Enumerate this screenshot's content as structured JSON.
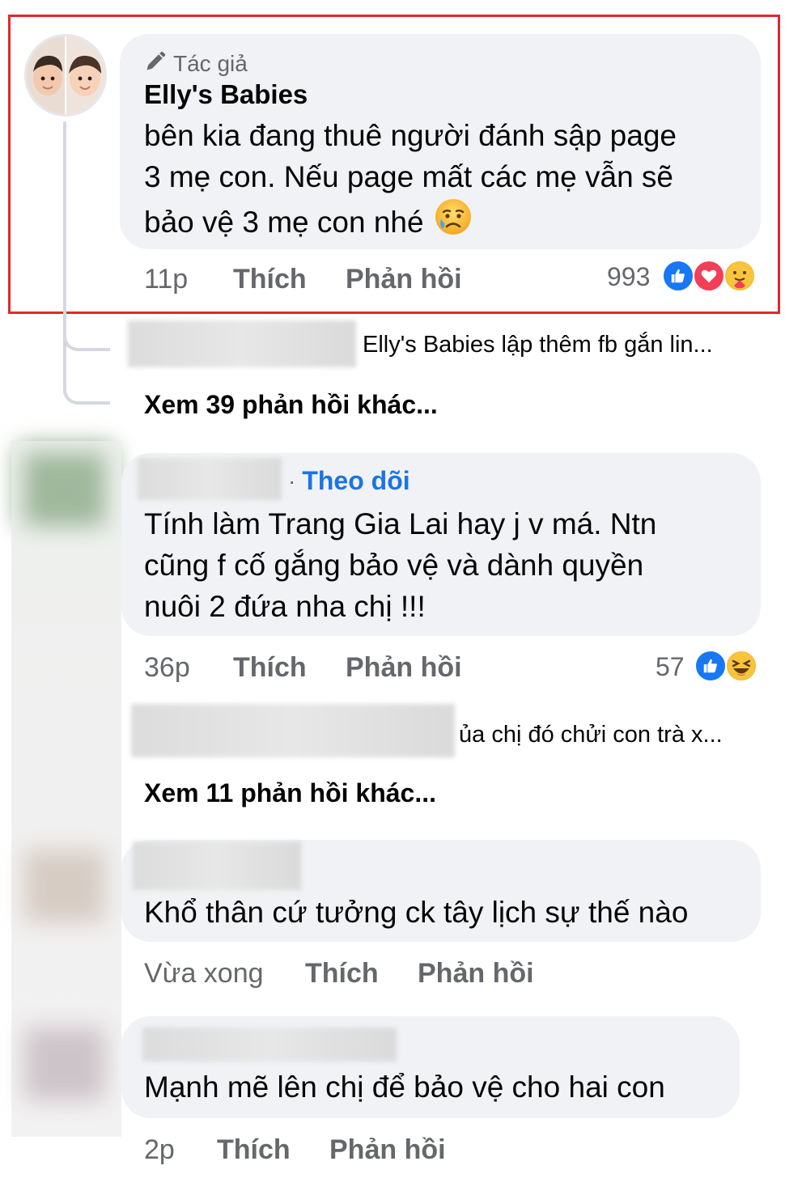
{
  "comments": [
    {
      "badge": "Tác giả",
      "author": "Elly's Babies",
      "lines": [
        "bên kia đang thuê người đánh sập page",
        "3 mẹ con. Nếu page mất các mẹ vẫn sẽ",
        "bảo vệ 3 mẹ con nhé"
      ],
      "emoji": "crying-face",
      "time": "11p",
      "like": "Thích",
      "reply": "Phản hồi",
      "reaction_count": "993",
      "reactions": [
        "like-icon",
        "love-icon",
        "care-icon"
      ],
      "preview_reply": "Elly's Babies lập thêm fb gắn lin...",
      "more_replies": "Xem 39 phản hồi khác..."
    },
    {
      "follow": "Theo dõi",
      "lines": [
        "Tính làm Trang Gia Lai hay j v má. Ntn",
        "cũng f cố gắng bảo vệ và dành quyền",
        "nuôi 2 đứa nha chị !!!"
      ],
      "time": "36p",
      "like": "Thích",
      "reply": "Phản hồi",
      "reaction_count": "57",
      "reactions": [
        "like-icon",
        "haha-icon"
      ],
      "preview_reply": "ủa chị đó chửi con trà x...",
      "more_replies": "Xem 11 phản hồi khác..."
    },
    {
      "lines": [
        "Khổ thân cứ tưởng ck tây lịch sự thế nào"
      ],
      "time": "Vừa xong",
      "like": "Thích",
      "reply": "Phản hồi"
    },
    {
      "lines": [
        "Mạnh mẽ lên chị để bảo vệ cho hai con"
      ],
      "time": "2p",
      "like": "Thích",
      "reply": "Phản hồi"
    }
  ],
  "colors": {
    "bubble": "#f0f2f5",
    "meta": "#65676b",
    "link": "#1b74e4",
    "highlight": "#e0282e",
    "like": "#1877f2",
    "love": "#f33e58"
  }
}
